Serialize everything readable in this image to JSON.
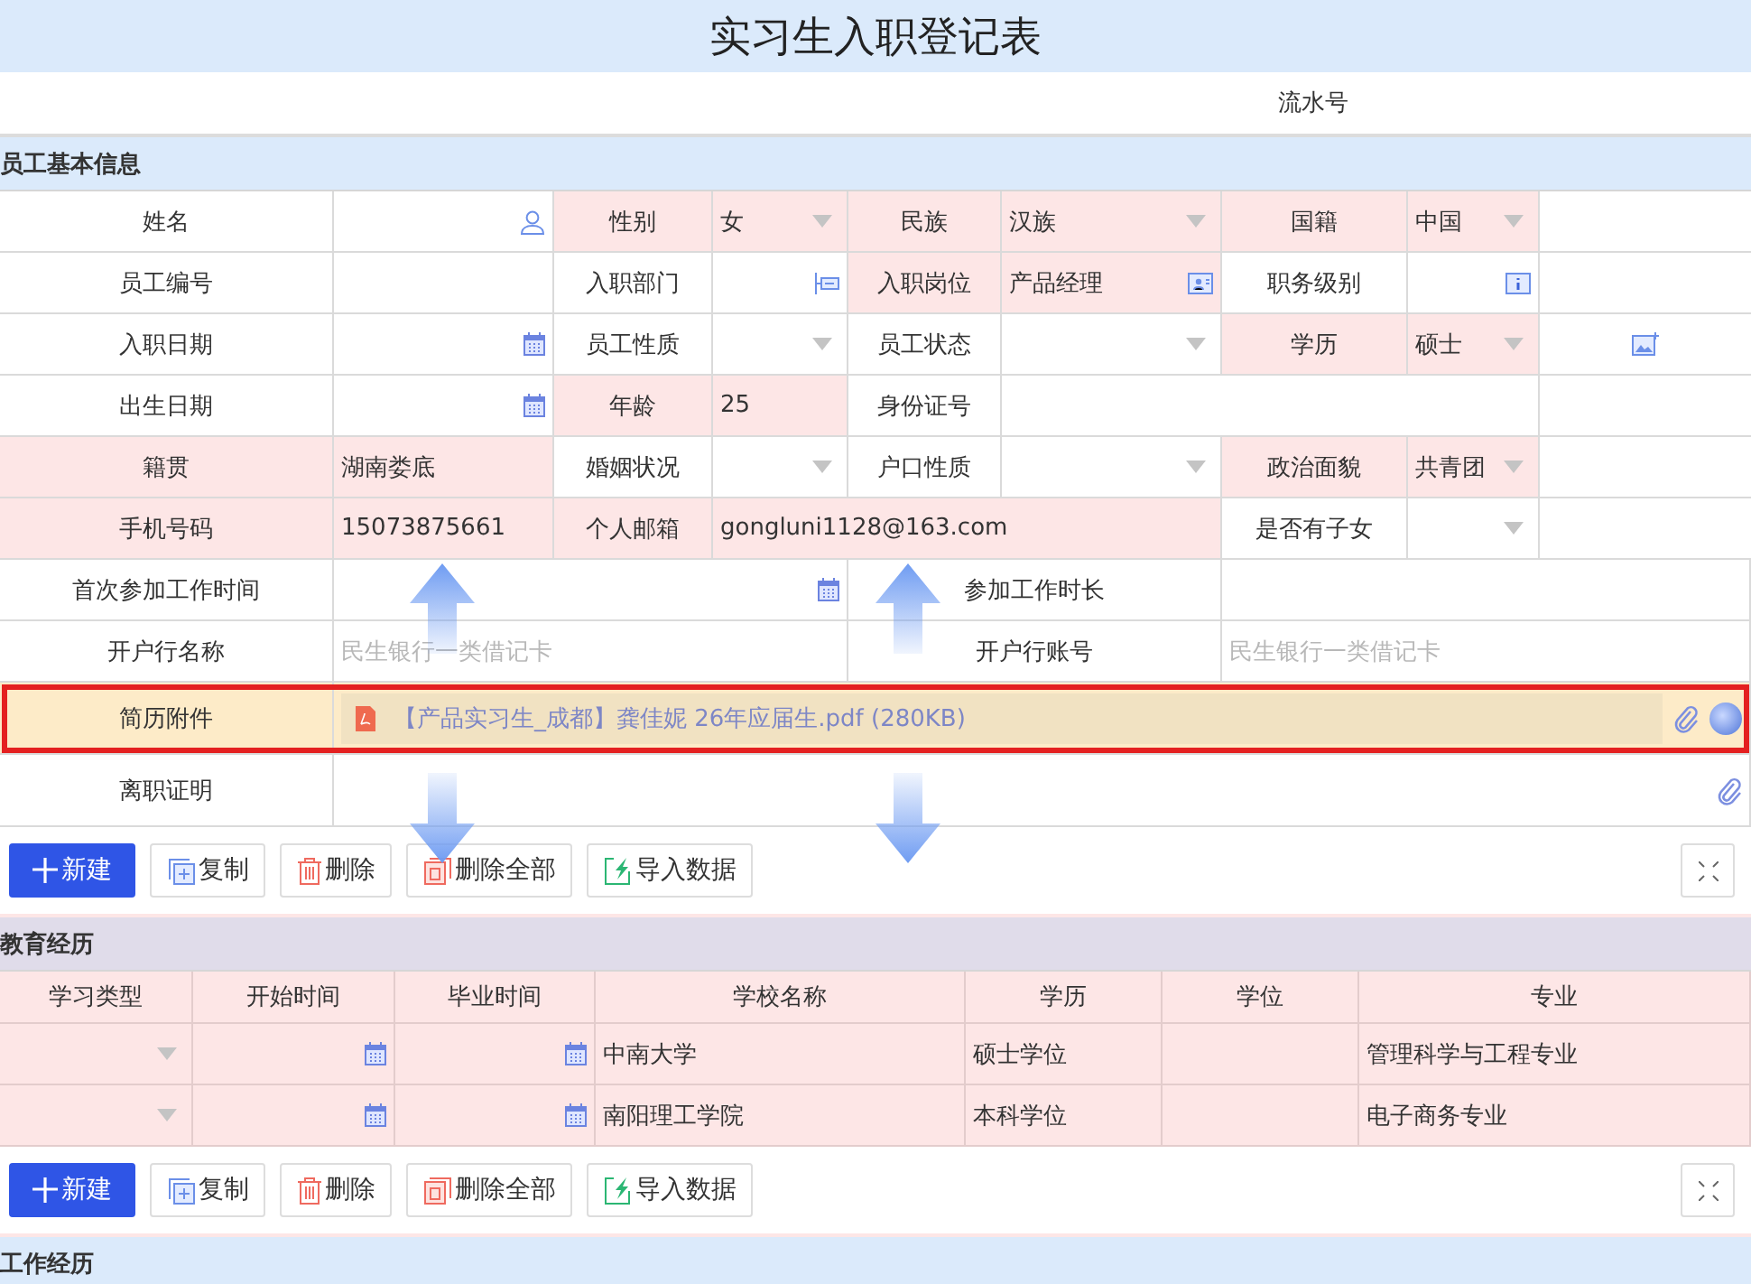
{
  "title": "实习生入职登记表",
  "serial_label": "流水号",
  "basic_info": {
    "heading": "员工基本信息",
    "rows": [
      {
        "outlined": false,
        "cells": [
          {
            "kind": "label",
            "text": "姓名",
            "highlighted": false
          },
          {
            "kind": "person",
            "highlighted": false
          },
          {
            "kind": "label",
            "text": "性别",
            "highlighted": true
          },
          {
            "kind": "select",
            "value": "女",
            "highlighted": true
          },
          {
            "kind": "label",
            "text": "民族",
            "highlighted": true
          },
          {
            "kind": "select",
            "value": "汉族",
            "highlighted": true
          },
          {
            "kind": "label",
            "text": "国籍",
            "highlighted": true
          },
          {
            "kind": "select",
            "value": "中国",
            "highlighted": true
          }
        ]
      },
      {
        "outlined": false,
        "cells": [
          {
            "kind": "label",
            "text": "员工编号",
            "highlighted": false
          },
          {
            "kind": "text",
            "highlighted": false
          },
          {
            "kind": "label",
            "text": "入职部门",
            "highlighted": false
          },
          {
            "kind": "dept",
            "highlighted": false
          },
          {
            "kind": "label",
            "text": "入职岗位",
            "highlighted": true
          },
          {
            "kind": "post",
            "value": "产品经理",
            "highlighted": true
          },
          {
            "kind": "label",
            "text": "职务级别",
            "highlighted": false
          },
          {
            "kind": "level",
            "highlighted": false
          }
        ]
      },
      {
        "outlined": false,
        "cells": [
          {
            "kind": "label",
            "text": "入职日期",
            "highlighted": false
          },
          {
            "kind": "date",
            "highlighted": false
          },
          {
            "kind": "label",
            "text": "员工性质",
            "highlighted": false
          },
          {
            "kind": "select",
            "highlighted": false
          },
          {
            "kind": "label",
            "text": "员工状态",
            "highlighted": false
          },
          {
            "kind": "select",
            "highlighted": false
          },
          {
            "kind": "label",
            "text": "学历",
            "highlighted": true
          },
          {
            "kind": "select",
            "value": "硕士",
            "highlighted": true
          },
          {
            "kind": "photo",
            "highlighted": false
          }
        ]
      },
      {
        "outlined": false,
        "cells": [
          {
            "kind": "label",
            "text": "出生日期",
            "highlighted": false
          },
          {
            "kind": "date",
            "highlighted": false
          },
          {
            "kind": "label",
            "text": "年龄",
            "highlighted": true
          },
          {
            "kind": "text",
            "value": "25",
            "highlighted": true
          },
          {
            "kind": "label",
            "text": "身份证号",
            "highlighted": false
          },
          {
            "kind": "text",
            "highlighted": false
          },
          {
            "kind": "merged"
          },
          {
            "kind": "merged"
          }
        ]
      },
      {
        "outlined": false,
        "cells": [
          {
            "kind": "label",
            "text": "籍贯",
            "highlighted": true
          },
          {
            "kind": "text",
            "value": "湖南娄底",
            "highlighted": true
          },
          {
            "kind": "label",
            "text": "婚姻状况",
            "highlighted": false
          },
          {
            "kind": "select",
            "highlighted": false
          },
          {
            "kind": "label",
            "text": "户口性质",
            "highlighted": false
          },
          {
            "kind": "select",
            "highlighted": false
          },
          {
            "kind": "label",
            "text": "政治面貌",
            "highlighted": true
          },
          {
            "kind": "select",
            "value": "共青团",
            "highlighted": true
          }
        ]
      },
      {
        "outlined": false,
        "cells": [
          {
            "kind": "label",
            "text": "手机号码",
            "highlighted": true
          },
          {
            "kind": "text",
            "value": "15073875661",
            "highlighted": true
          },
          {
            "kind": "label",
            "text": "个人邮箱",
            "highlighted": true
          },
          {
            "kind": "text",
            "value": "gongluni1128@163.com",
            "highlighted": true
          },
          {
            "kind": "merged"
          },
          {
            "kind": "merged"
          },
          {
            "kind": "label",
            "text": "是否有子女",
            "highlighted": false
          },
          {
            "kind": "select",
            "highlighted": false
          }
        ]
      },
      {
        "outlined": false,
        "cells": [
          {
            "kind": "label",
            "text": "首次参加工作时间",
            "highlighted": false
          },
          {
            "kind": "date",
            "highlighted": false
          },
          {
            "kind": "merged"
          },
          {
            "kind": "merged"
          },
          {
            "kind": "label",
            "text": "参加工作时长",
            "highlighted": false
          },
          {
            "kind": "merged"
          },
          {
            "kind": "text",
            "highlighted": false
          },
          {
            "kind": "merged"
          },
          {
            "kind": "merged"
          }
        ]
      },
      {
        "outlined": false,
        "cells": [
          {
            "kind": "label",
            "text": "开户行名称",
            "highlighted": false
          },
          {
            "kind": "text",
            "placeholder": "民生银行一类借记卡",
            "highlighted": false
          },
          {
            "kind": "merged"
          },
          {
            "kind": "merged"
          },
          {
            "kind": "label",
            "text": "开户行账号",
            "highlighted": false
          },
          {
            "kind": "merged"
          },
          {
            "kind": "text",
            "placeholder": "民生银行一类借记卡",
            "highlighted": false
          },
          {
            "kind": "merged"
          },
          {
            "kind": "merged"
          }
        ]
      },
      {
        "outlined": true,
        "cells": [
          {
            "kind": "label",
            "text": "简历附件",
            "highlighted": true
          },
          {
            "kind": "attachment",
            "file": "【产品实习生_成都】龚佳妮 26年应届生.pdf (280KB)",
            "highlighted": true
          },
          {
            "kind": "merged"
          },
          {
            "kind": "merged"
          },
          {
            "kind": "merged"
          },
          {
            "kind": "merged"
          },
          {
            "kind": "merged"
          },
          {
            "kind": "merged"
          },
          {
            "kind": "merged"
          }
        ]
      },
      {
        "outlined": false,
        "cells": [
          {
            "kind": "label",
            "text": "离职证明",
            "highlighted": false
          },
          {
            "kind": "attachment",
            "highlighted": false
          },
          {
            "kind": "merged"
          },
          {
            "kind": "merged"
          },
          {
            "kind": "merged"
          },
          {
            "kind": "merged"
          },
          {
            "kind": "merged"
          },
          {
            "kind": "merged"
          },
          {
            "kind": "merged"
          }
        ]
      }
    ],
    "toolbar": [
      {
        "kind": "new",
        "label": "新建"
      },
      {
        "kind": "copy",
        "label": "复制"
      },
      {
        "kind": "delete",
        "label": "删除"
      },
      {
        "kind": "delete_all",
        "label": "删除全部"
      },
      {
        "kind": "import",
        "label": "导入数据"
      },
      {
        "kind": "expand"
      }
    ]
  },
  "education": {
    "heading": "教育经历",
    "columns": [
      "学习类型",
      "开始时间",
      "毕业时间",
      "学校名称",
      "学历",
      "学位",
      "专业"
    ],
    "rows": [
      [
        {
          "kind": "select"
        },
        {
          "kind": "date"
        },
        {
          "kind": "date"
        },
        {
          "kind": "text",
          "value": "中南大学"
        },
        {
          "kind": "text",
          "value": "硕士学位"
        },
        {
          "kind": "text"
        },
        {
          "kind": "text",
          "value": "管理科学与工程专业"
        }
      ],
      [
        {
          "kind": "select"
        },
        {
          "kind": "date"
        },
        {
          "kind": "date"
        },
        {
          "kind": "text",
          "value": "南阳理工学院"
        },
        {
          "kind": "text",
          "value": "本科学位"
        },
        {
          "kind": "text"
        },
        {
          "kind": "text",
          "value": "电子商务专业"
        }
      ]
    ],
    "toolbar": [
      {
        "kind": "new",
        "label": "新建"
      },
      {
        "kind": "copy",
        "label": "复制"
      },
      {
        "kind": "delete",
        "label": "删除"
      },
      {
        "kind": "delete_all",
        "label": "删除全部"
      },
      {
        "kind": "import",
        "label": "导入数据"
      },
      {
        "kind": "expand"
      }
    ]
  },
  "work": {
    "heading": "工作经历"
  }
}
